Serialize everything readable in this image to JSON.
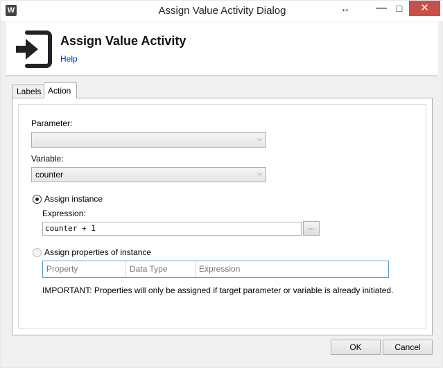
{
  "window": {
    "title": "Assign Value Activity Dialog",
    "app_icon_letter": "W",
    "controls": {
      "resize": "↔",
      "minimize": "—",
      "maximize": "□",
      "close": "✕"
    }
  },
  "header": {
    "title": "Assign Value Activity",
    "help_link": "Help",
    "icon": "enter-arrow-icon"
  },
  "tabs": [
    {
      "label": "Labels",
      "selected": false
    },
    {
      "label": "Action",
      "selected": true
    }
  ],
  "form": {
    "parameter_label": "Parameter:",
    "parameter_value": "",
    "variable_label": "Variable:",
    "variable_value": "counter",
    "assign_instance": {
      "label": "Assign instance",
      "selected": true
    },
    "expression_label": "Expression:",
    "expression_value": "counter + 1",
    "browse_label": "...",
    "assign_properties": {
      "label": "Assign properties of instance",
      "selected": false
    },
    "columns": [
      "Property",
      "Data Type",
      "Expression"
    ],
    "note": "IMPORTANT: Properties will only be assigned if target parameter or variable is already initiated."
  },
  "footer": {
    "ok": "OK",
    "cancel": "Cancel"
  },
  "colors": {
    "close_button": "#c7504a",
    "link": "#0036c7",
    "grid_border": "#5b9bd5"
  }
}
